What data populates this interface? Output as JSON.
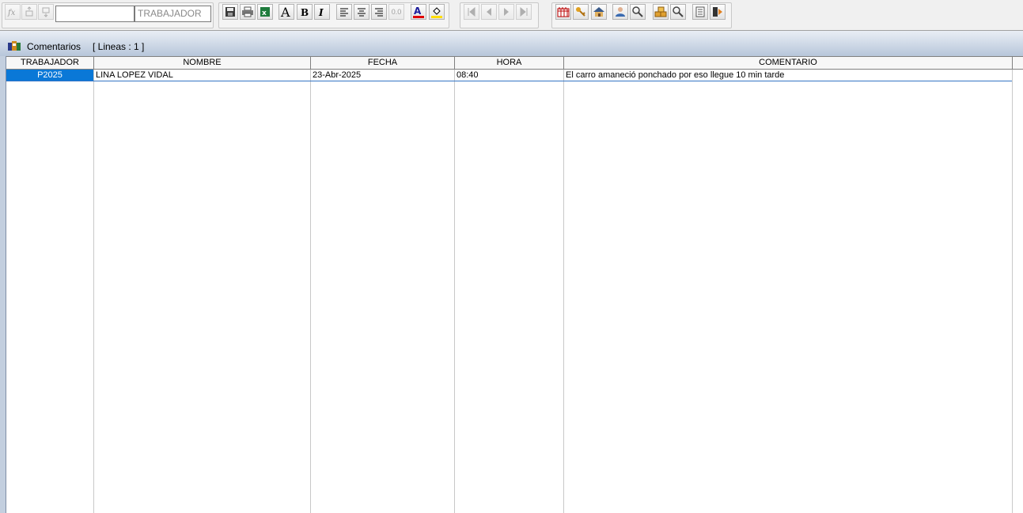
{
  "toolbar": {
    "formula_icon": "fx-icon",
    "field_value": "",
    "field_name": "TRABAJADOR",
    "numeric_format_label": "0.0"
  },
  "window": {
    "title": "Comentarios",
    "lines_label": "[ Lineas : 1 ]"
  },
  "grid": {
    "columns": [
      "TRABAJADOR",
      "NOMBRE",
      "FECHA",
      "HORA",
      "COMENTARIO"
    ],
    "rows": [
      {
        "trabajador": "P2025",
        "nombre": "LINA LOPEZ VIDAL",
        "fecha": "23-Abr-2025",
        "hora": "08:40",
        "comentario": "El carro amaneció ponchado por eso llegue 10 min tarde"
      }
    ]
  },
  "colors": {
    "selection": "#0a78d7",
    "row_border": "#3574c4",
    "title_gradient_end": "#b7c6da"
  }
}
